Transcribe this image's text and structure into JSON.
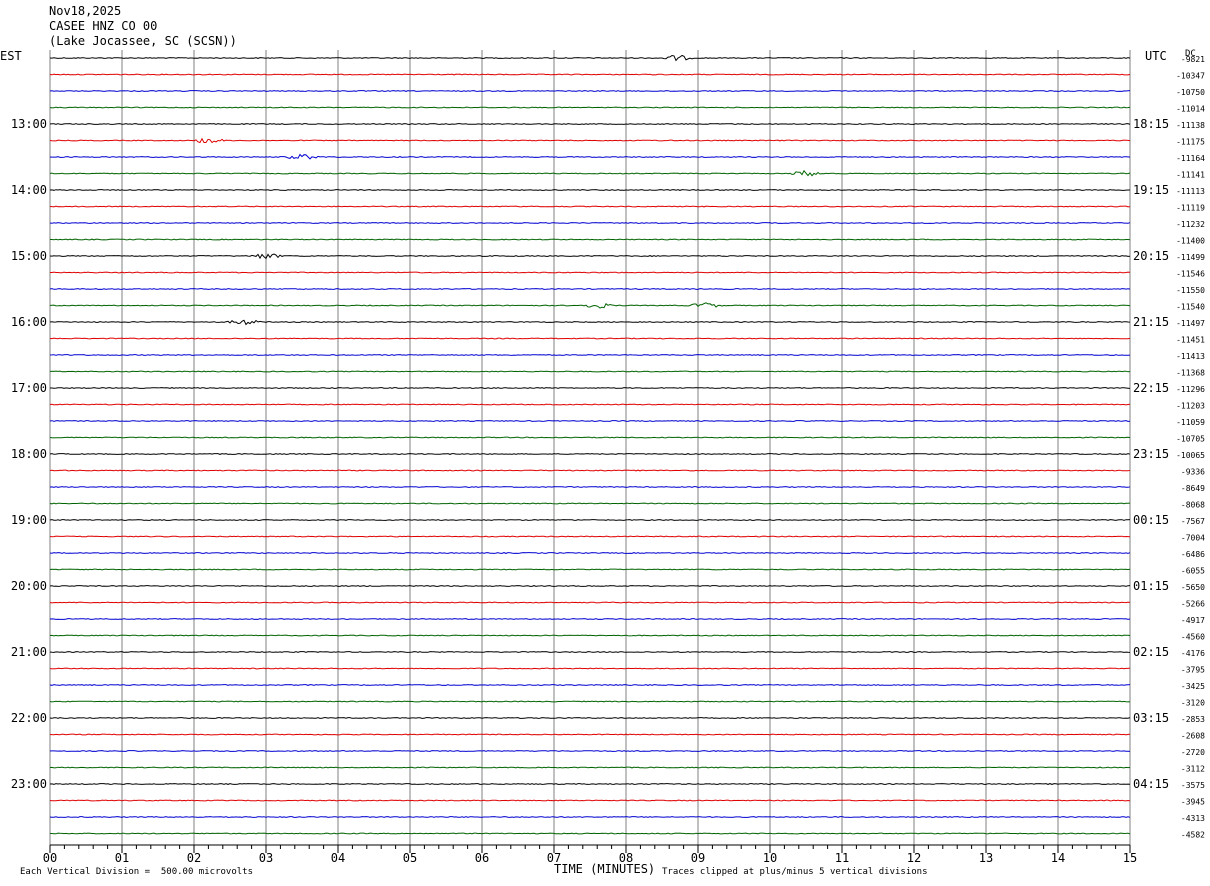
{
  "header": {
    "date": "Nov18,2025",
    "station": "CASEE HNZ CO 00",
    "location": "(Lake Jocassee, SC (SCSN))"
  },
  "left_tz": "EST",
  "right_tz": "UTC",
  "dc_label": "DC",
  "xlabel": "TIME (MINUTES)",
  "footer_left": "Each Vertical Division =  500.00 microvolts",
  "footer_right": "Traces clipped at plus/minus 5 vertical divisions",
  "colors": {
    "black": "#000000",
    "red": "#e00000",
    "blue": "#0000d0",
    "green": "#006400",
    "grid": "#808080"
  },
  "chart_data": {
    "type": "line",
    "title": "CASEE HNZ CO 00",
    "x_ticks": [
      "00",
      "01",
      "02",
      "03",
      "04",
      "05",
      "06",
      "07",
      "08",
      "09",
      "10",
      "11",
      "12",
      "13",
      "14",
      "15"
    ],
    "xlim": [
      0,
      15
    ],
    "trace_minutes_per_line": 15,
    "trace_color_cycle": [
      "black",
      "red",
      "blue",
      "green"
    ],
    "left_hour_labels": [
      "13:00",
      "14:00",
      "15:00",
      "16:00",
      "17:00",
      "18:00",
      "19:00",
      "20:00",
      "21:00",
      "22:00",
      "23:00"
    ],
    "right_hour_labels": [
      "18:15",
      "19:15",
      "20:15",
      "21:15",
      "22:15",
      "23:15",
      "00:15",
      "01:15",
      "02:15",
      "03:15",
      "04:15"
    ],
    "dc_offsets": [
      -9821,
      -10347,
      -10750,
      -11014,
      -11138,
      -11175,
      -11164,
      -11141,
      -11113,
      -11119,
      -11232,
      -11400,
      -11499,
      -11546,
      -11550,
      -11540,
      -11497,
      -11451,
      -11413,
      -11368,
      -11296,
      -11203,
      -11059,
      -10705,
      -10065,
      -9336,
      -8649,
      -8068,
      -7567,
      -7004,
      -6486,
      -6055,
      -5650,
      -5266,
      -4917,
      -4560,
      -4176,
      -3795,
      -3425,
      -3120,
      -2853,
      -2608,
      -2720,
      -3112,
      -3575,
      -3945,
      -4313,
      -4582
    ],
    "events": [
      {
        "trace": 0,
        "minute": 8.7
      },
      {
        "trace": 5,
        "minute": 2.2
      },
      {
        "trace": 6,
        "minute": 3.5
      },
      {
        "trace": 7,
        "minute": 10.5
      },
      {
        "trace": 12,
        "minute": 3.0
      },
      {
        "trace": 15,
        "minute": 7.6
      },
      {
        "trace": 15,
        "minute": 9.1
      },
      {
        "trace": 16,
        "minute": 2.7
      }
    ]
  }
}
